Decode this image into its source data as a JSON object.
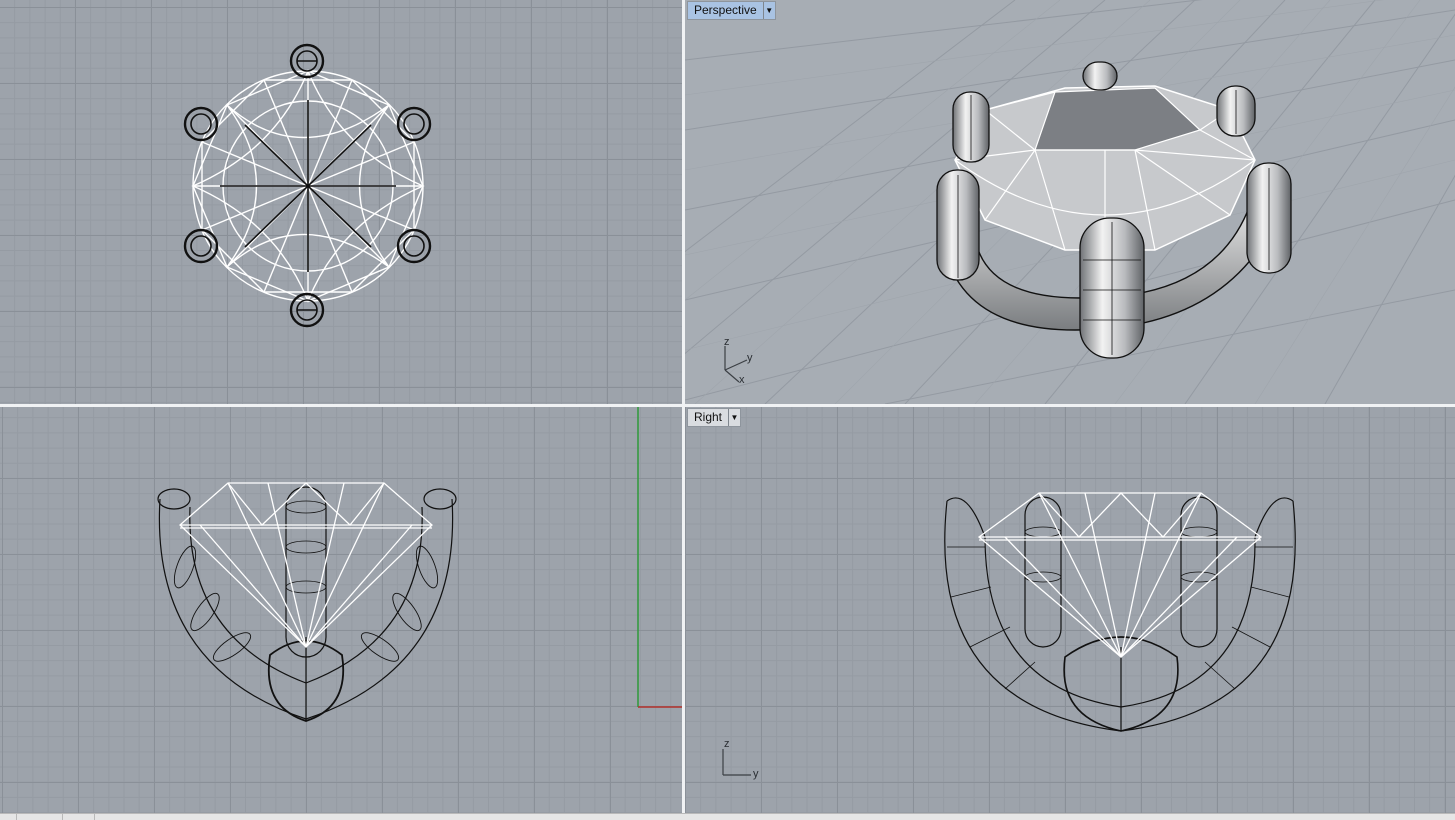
{
  "viewports": {
    "perspective": {
      "title": "Perspective",
      "active": true,
      "axes": [
        "z",
        "y",
        "x"
      ]
    },
    "right": {
      "title": "Right",
      "active": false,
      "axes": [
        "z",
        "y"
      ]
    }
  },
  "colors": {
    "viewport_bg": "#9da3ab",
    "grid_major": "#8a9098",
    "grid_minor": "#959ba3",
    "active_tab": "#a9c3e3",
    "wire_white": "#ffffff",
    "wire_black": "#111111",
    "x_axis": "#b2302a",
    "y_axis": "#2f9a3a"
  },
  "icons": {
    "dropdown": "chevron-down-icon"
  }
}
